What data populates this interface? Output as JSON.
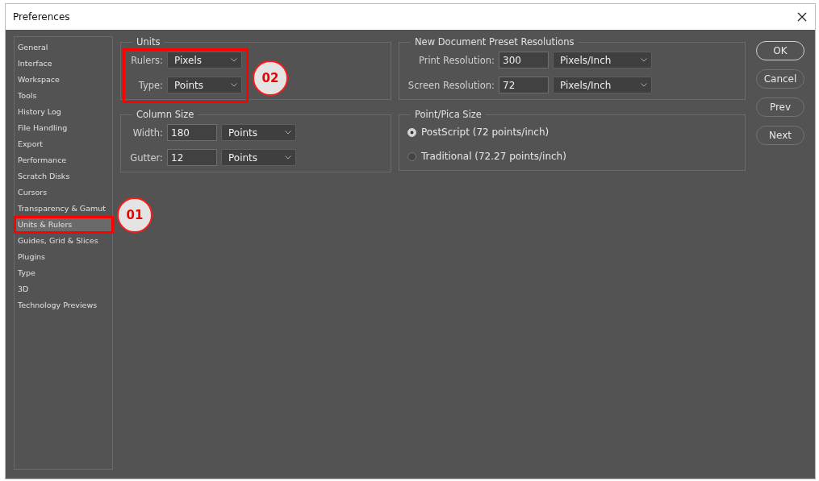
{
  "window": {
    "title": "Preferences"
  },
  "sidebar": {
    "items": [
      {
        "label": "General",
        "selected": false
      },
      {
        "label": "Interface",
        "selected": false
      },
      {
        "label": "Workspace",
        "selected": false
      },
      {
        "label": "Tools",
        "selected": false
      },
      {
        "label": "History Log",
        "selected": false
      },
      {
        "label": "File Handling",
        "selected": false
      },
      {
        "label": "Export",
        "selected": false
      },
      {
        "label": "Performance",
        "selected": false
      },
      {
        "label": "Scratch Disks",
        "selected": false
      },
      {
        "label": "Cursors",
        "selected": false
      },
      {
        "label": "Transparency & Gamut",
        "selected": false
      },
      {
        "label": "Units & Rulers",
        "selected": true
      },
      {
        "label": "Guides, Grid & Slices",
        "selected": false
      },
      {
        "label": "Plugins",
        "selected": false
      },
      {
        "label": "Type",
        "selected": false
      },
      {
        "label": "3D",
        "selected": false
      },
      {
        "label": "Technology Previews",
        "selected": false
      }
    ]
  },
  "units": {
    "title": "Units",
    "rows": [
      {
        "label": "Rulers:",
        "unit": "Pixels"
      },
      {
        "label": "Type:",
        "unit": "Points"
      }
    ]
  },
  "column_size": {
    "title": "Column Size",
    "rows": [
      {
        "label": "Width:",
        "value": "180",
        "unit": "Points"
      },
      {
        "label": "Gutter:",
        "value": "12",
        "unit": "Points"
      }
    ]
  },
  "resolutions": {
    "title": "New Document Preset Resolutions",
    "rows": [
      {
        "label": "Print Resolution:",
        "value": "300",
        "unit": "Pixels/Inch"
      },
      {
        "label": "Screen Resolution:",
        "value": "72",
        "unit": "Pixels/Inch"
      }
    ]
  },
  "point_pica": {
    "title": "Point/Pica Size",
    "options": [
      {
        "label": "PostScript (72 points/inch)",
        "selected": true
      },
      {
        "label": "Traditional (72.27 points/inch)",
        "selected": false
      }
    ]
  },
  "buttons": [
    {
      "label": "OK",
      "default": true
    },
    {
      "label": "Cancel",
      "default": false
    },
    {
      "label": "Prev",
      "default": false
    },
    {
      "label": "Next",
      "default": false
    }
  ],
  "annotations": [
    {
      "label": "01"
    },
    {
      "label": "02"
    }
  ]
}
